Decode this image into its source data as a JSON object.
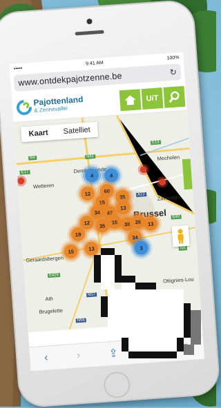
{
  "status_bar": {
    "carrier": "••••• ",
    "time": "9:41 AM",
    "battery": "100%"
  },
  "browser": {
    "url": "www.ontdekpajotzenne.be",
    "reload_icon": "reload-icon"
  },
  "site": {
    "logo_line1": "Pajottenland",
    "logo_line2": "& Zennevallei",
    "uit_label": "UiT"
  },
  "map": {
    "tabs": [
      "Kaart",
      "Satelliet"
    ],
    "active_tab": "Kaart",
    "labels": {
      "dendermonde": "Dendermonde",
      "wetteren": "Wetteren",
      "mechelen": "Mechelen",
      "zaventem": "Zaventem",
      "brussel": "Brussel",
      "geraardsbergen": "Geraardsbergen",
      "ath": "Ath",
      "brugelette": "Brugelette",
      "ottignies": "Ottignies-Lou"
    },
    "road_tags": {
      "r4": "R4",
      "n41": "N41",
      "e19": "E19",
      "e17": "E17",
      "a12": "A12",
      "e40": "E40",
      "e429": "E429",
      "n57": "N57",
      "n56": "N56",
      "n4": "N4"
    },
    "clusters": [
      {
        "label": "4",
        "color": "blue"
      },
      {
        "label": "4",
        "color": "blue"
      },
      {
        "label": "12",
        "color": "orange"
      },
      {
        "label": "60",
        "color": "orange"
      },
      {
        "label": "35",
        "color": "orange"
      },
      {
        "label": "15",
        "color": "orange"
      },
      {
        "label": "34",
        "color": "orange"
      },
      {
        "label": "47",
        "color": "orange"
      },
      {
        "label": "13",
        "color": "orange"
      },
      {
        "label": "12",
        "color": "orange"
      },
      {
        "label": "35",
        "color": "orange"
      },
      {
        "label": "15",
        "color": "orange"
      },
      {
        "label": "38",
        "color": "orange"
      },
      {
        "label": "26",
        "color": "orange"
      },
      {
        "label": "13",
        "color": "orange"
      },
      {
        "label": "19",
        "color": "orange"
      },
      {
        "label": "15",
        "color": "orange"
      },
      {
        "label": "13",
        "color": "orange"
      },
      {
        "label": "34",
        "color": "orange"
      },
      {
        "label": "3",
        "color": "blue"
      }
    ]
  },
  "colors": {
    "brand_green": "#8cc43a",
    "brand_blue": "#1b6d9c",
    "cluster_orange": "#e8862a",
    "cluster_blue": "#3e8ed8"
  },
  "toolbar": {
    "back": "‹",
    "forward": "›",
    "share": "⇪",
    "bookmarks": "▯",
    "tabs": "⧉"
  }
}
